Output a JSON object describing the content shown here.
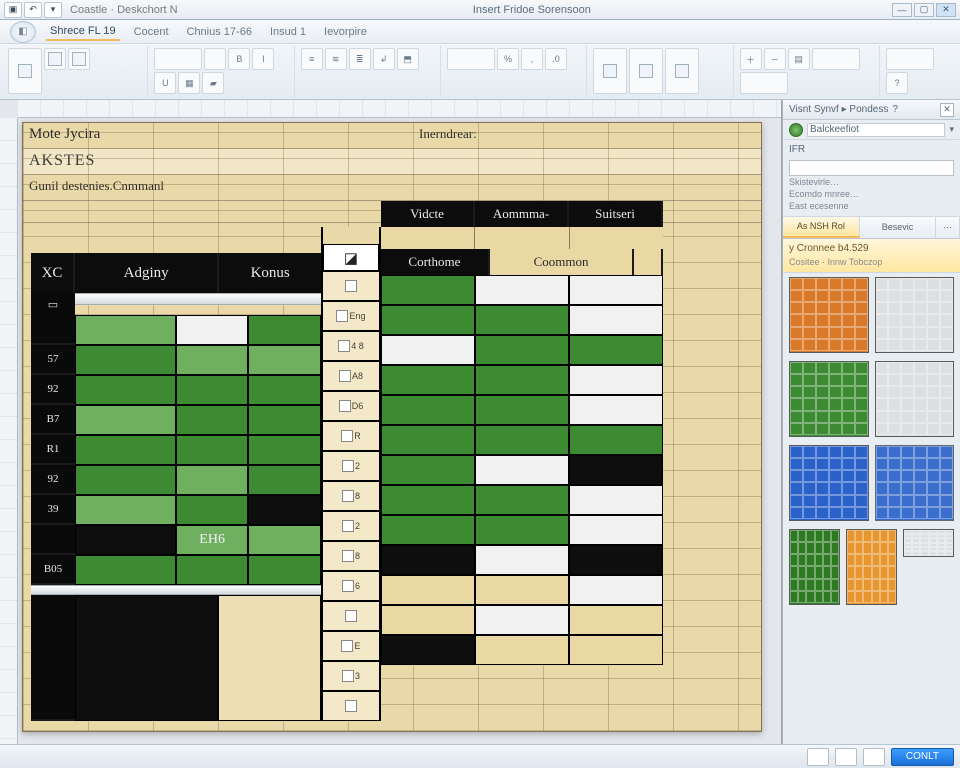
{
  "titlebar": {
    "doc_left": "Coastle · Deskchort N",
    "doc_center": "Insert Fridoe   Sorensoon"
  },
  "ribbon": {
    "tabs": [
      "Shrece FL 19",
      "Cocent",
      "Chnius 17-66",
      "Insud 1",
      "Ievorpire"
    ]
  },
  "sheet": {
    "row1_a": "Mote Jycira",
    "row1_b": "Inerndrear:",
    "row2_a": "AKSTES",
    "row3_a": "Gunil destenies.Cnmmanl"
  },
  "table": {
    "left_header": {
      "c1": "XC",
      "c2": "Adginy",
      "c3": "Konus"
    },
    "right_upper": [
      "Vidcte",
      "Aommma-",
      "Suitseri"
    ],
    "right_lower": [
      "Corthome",
      "Coommon"
    ],
    "stubs": [
      "",
      "57",
      "92",
      "B7",
      "R1",
      "92",
      "39",
      "",
      "B05"
    ],
    "midcol": [
      "",
      "Eng",
      "4 8",
      "A8",
      "D6",
      "R",
      "2",
      "8",
      "2",
      "8",
      "6",
      "",
      "E",
      "3",
      ""
    ],
    "center_label": "EH6"
  },
  "panel": {
    "title": "Visnt Synvf ▸ Pondess",
    "sub_label": "Balckeefiot",
    "search_hdr": "IFR",
    "search_value": "",
    "lines": [
      "Skistevirle…",
      "Ecomdo mnree…",
      "East ecesenne"
    ],
    "tab1": "As NSH Rol",
    "tab2": "Besevic",
    "caption": "y Cronnee b4.529",
    "subcap": "Cositee  ·  Innw Tobczop"
  },
  "status": {
    "ok": "CONLT"
  }
}
